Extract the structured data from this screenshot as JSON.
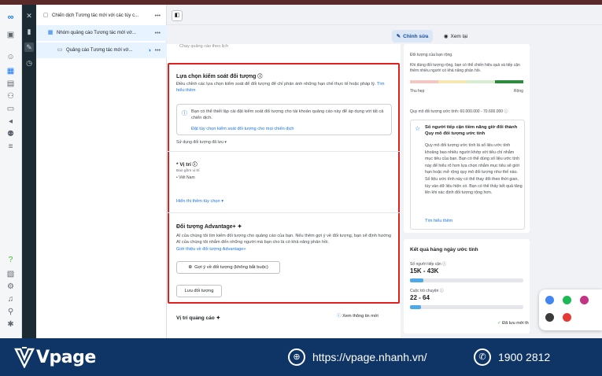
{
  "tree": {
    "campaign": "Chiến dịch Tương tác mới với các túy c...",
    "adset": "Nhóm quảng cáo Tương tác mới vớ...",
    "ad": "Quảng cáo Tương tác mới vớ..."
  },
  "toolbar": {
    "edit_label": "Chỉnh sửa",
    "view_label": "Xem lại"
  },
  "main": {
    "faded_top": "Chạy quảng cáo theo lịch",
    "audience_control": {
      "title": "Lựa chọn kiểm soát đối tượng",
      "desc": "Điều chỉnh các lựa chọn kiểm soát để đối tượng để chỉ phản ánh những hạn chế thực tế hoặc pháp lý.",
      "learn_more": "Tìm hiểu thêm",
      "info_text": "Bạn có thể thiết lập cài đặt kiểm soát đối tượng cho tài khoản quảng cáo này để áp dụng với tất cả chiến dịch.",
      "info_link": "Đặt tùy chọn kiểm soát đối tượng cho mọi chiến dịch",
      "saved_audience": "Sử dụng đối tượng đã lưu"
    },
    "location": {
      "title": "* Vị trí",
      "included_label": "Bao gồm vị trí",
      "country": "Việt Nam",
      "more_options": "Hiển thị thêm tùy chọn"
    },
    "advantage": {
      "title": "Đối tượng Advantage+",
      "desc": "AI của chúng tôi tìm kiếm đối tượng cho quảng cáo của bạn. Nếu thêm gợi ý về đối tượng, bạn sẽ định hướng AI của chúng tôi nhắm đến những người mà bạn cho là có khả năng phản hồi.",
      "intro_link": "Giới thiệu về đối tượng Advantage+",
      "suggest_btn": "Gợi ý về đối tượng (không bắt buộc)",
      "save_btn": "Lưu đối tượng"
    },
    "placement": {
      "title": "Vị trí quảng cáo",
      "info_link": "Xem thông tin mới"
    },
    "saved_status": "Đã lưu mới th"
  },
  "right": {
    "audience_def_title": "Đối tượng của bạn rộng.",
    "audience_def_text": "Khi dùng đối tượng rộng, bạn có thể chiến hiệu quả và tiếp cận thêm nhiều người có khả năng phản hồi.",
    "specific": "Thu hẹp",
    "broad": "Rộng",
    "size_estimate": "Quy mô đối tượng ước tính: 60.000.000 - 70.600.000",
    "tip_title": "Số người tiếp cận tiềm năng giờ đổi thành Quy mô đối tượng ước tính",
    "tip_body": "Quy mô đối tượng ước tính là số liệu ước tính khoảng bao nhiêu người khớp với tiêu chí nhắm mục tiêu của bạn. Bạn có thể dùng số liệu ước tính này để hiểu rõ hơn lựa chọn nhắm mục tiêu sẽ giới hạn hoặc mở rộng quy mô đối tượng như thế nào. Số liệu ước tính này có thể thay đổi theo thời gian, tùy vào dữ liệu hiện có. Bạn có thể thấy kết quả tăng lên khi xác định đối tượng rộng hơn.",
    "tip_link": "Tìm hiểu thêm",
    "daily_title": "Kết quả hàng ngày ước tính",
    "reach_label": "Số người tiếp cận",
    "reach_value": "15K - 43K",
    "reach_fill": 0.12,
    "conv_label": "Cuộc trò chuyện",
    "conv_value": "22 - 64",
    "conv_fill": 0.1
  },
  "banner": {
    "brand": "Vpage",
    "url": "https://vpage.nhanh.vn/",
    "phone": "1900 2812"
  },
  "colors": {
    "accent": "#1b74e4",
    "highlight_box": "#e0201d",
    "banner": "#0f3566"
  }
}
